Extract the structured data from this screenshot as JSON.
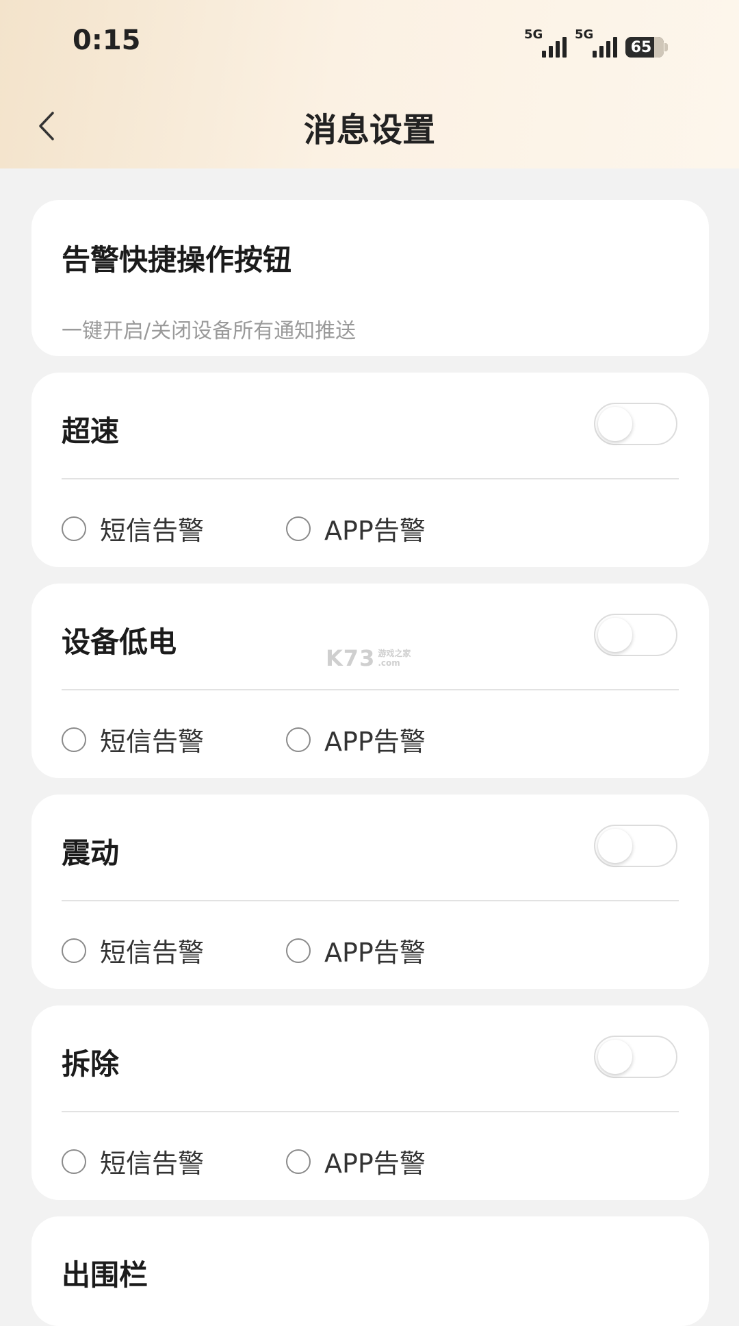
{
  "status_bar": {
    "time": "0:15",
    "signal1_label": "5G",
    "signal2_label": "5G",
    "battery": "65"
  },
  "header": {
    "title": "消息设置"
  },
  "quick_card": {
    "title": "告警快捷操作按钮",
    "subtitle": "一键开启/关闭设备所有通知推送"
  },
  "alert_cards": [
    {
      "title": "超速",
      "enabled": false,
      "sms_label": "短信告警",
      "app_label": "APP告警"
    },
    {
      "title": "设备低电",
      "enabled": false,
      "sms_label": "短信告警",
      "app_label": "APP告警"
    },
    {
      "title": "震动",
      "enabled": false,
      "sms_label": "短信告警",
      "app_label": "APP告警"
    },
    {
      "title": "拆除",
      "enabled": false,
      "sms_label": "短信告警",
      "app_label": "APP告警"
    }
  ],
  "fence_card": {
    "title": "出围栏"
  },
  "watermark": {
    "brand": "K73",
    "line1": "游戏之家",
    "line2": ".com"
  }
}
